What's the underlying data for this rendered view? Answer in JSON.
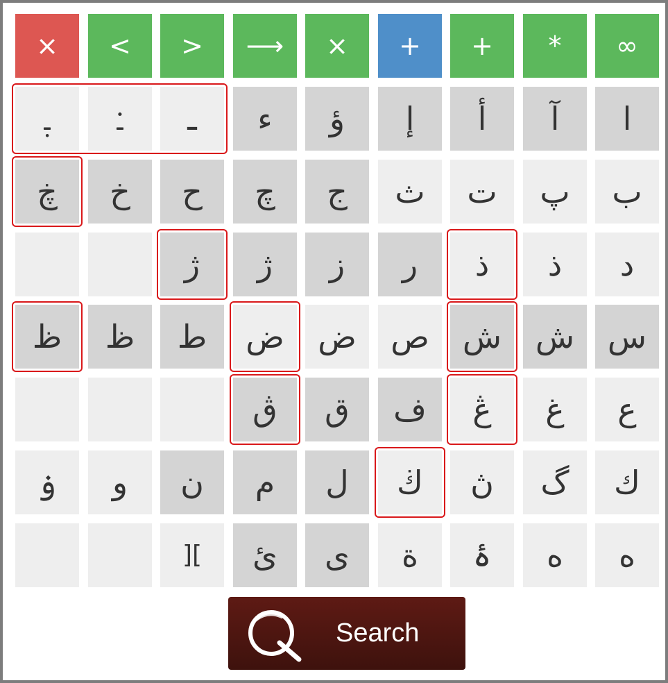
{
  "colors": {
    "clear": "#dd5752",
    "control": "#5cb85c",
    "control_active": "#4f8fc9",
    "key_light": "#eeeeee",
    "key_dark": "#d4d4d4",
    "text": "#333333",
    "outline": "#d9181a",
    "search_bg": "#4a1610"
  },
  "controls": [
    {
      "label": "×",
      "style": "clear",
      "name": "clear-button"
    },
    {
      "label": "<",
      "style": "control",
      "name": "left-arrow-button"
    },
    {
      "label": ">",
      "style": "control",
      "name": "right-arrow-button"
    },
    {
      "label": "⟶",
      "style": "control",
      "name": "long-arrow-button"
    },
    {
      "label": "×",
      "style": "control",
      "name": "backspace-button"
    },
    {
      "label": "+",
      "style": "control_active",
      "name": "plus-active-button"
    },
    {
      "label": "+",
      "style": "control",
      "name": "plus-button"
    },
    {
      "label": "*",
      "style": "control",
      "name": "wildcard-button"
    },
    {
      "label": "∞",
      "style": "control",
      "name": "infinity-button"
    }
  ],
  "rows": [
    [
      {
        "char": "ـٜ",
        "shade": "light",
        "marked": true
      },
      {
        "char": "ـ۬",
        "shade": "light",
        "marked": true
      },
      {
        "char": "ـ",
        "shade": "light",
        "marked": true
      },
      {
        "char": "ء",
        "shade": "dark"
      },
      {
        "char": "ؤ",
        "shade": "dark"
      },
      {
        "char": "إ",
        "shade": "dark"
      },
      {
        "char": "أ",
        "shade": "dark"
      },
      {
        "char": "آ",
        "shade": "dark"
      },
      {
        "char": "ا",
        "shade": "dark"
      }
    ],
    [
      {
        "char": "ڿ",
        "shade": "dark",
        "marked": true
      },
      {
        "char": "خ",
        "shade": "dark"
      },
      {
        "char": "ح",
        "shade": "dark"
      },
      {
        "char": "چ",
        "shade": "dark"
      },
      {
        "char": "ج",
        "shade": "dark"
      },
      {
        "char": "ث",
        "shade": "light"
      },
      {
        "char": "ت",
        "shade": "light"
      },
      {
        "char": "پ",
        "shade": "light"
      },
      {
        "char": "ب",
        "shade": "light"
      }
    ],
    [
      {
        "char": "",
        "shade": "blank"
      },
      {
        "char": "",
        "shade": "blank"
      },
      {
        "char": "ژ",
        "shade": "dark",
        "marked": true
      },
      {
        "char": "ژ",
        "shade": "dark"
      },
      {
        "char": "ز",
        "shade": "dark"
      },
      {
        "char": "ر",
        "shade": "dark"
      },
      {
        "char": "ذ",
        "shade": "light",
        "marked": true
      },
      {
        "char": "ذ",
        "shade": "light"
      },
      {
        "char": "د",
        "shade": "light"
      }
    ],
    [
      {
        "char": "ظ",
        "shade": "dark",
        "marked": true
      },
      {
        "char": "ظ",
        "shade": "dark"
      },
      {
        "char": "ط",
        "shade": "dark"
      },
      {
        "char": "ض",
        "shade": "light",
        "marked": true
      },
      {
        "char": "ض",
        "shade": "light"
      },
      {
        "char": "ص",
        "shade": "light"
      },
      {
        "char": "ش",
        "shade": "dark",
        "marked": true
      },
      {
        "char": "ش",
        "shade": "dark"
      },
      {
        "char": "س",
        "shade": "dark"
      }
    ],
    [
      {
        "char": "",
        "shade": "blank"
      },
      {
        "char": "",
        "shade": "blank"
      },
      {
        "char": "",
        "shade": "blank"
      },
      {
        "char": "ڨ",
        "shade": "dark",
        "marked": true
      },
      {
        "char": "ق",
        "shade": "dark"
      },
      {
        "char": "ف",
        "shade": "dark"
      },
      {
        "char": "ڠ",
        "shade": "light",
        "marked": true
      },
      {
        "char": "غ",
        "shade": "light"
      },
      {
        "char": "ع",
        "shade": "light"
      }
    ],
    [
      {
        "char": "ۏ",
        "shade": "light"
      },
      {
        "char": "و",
        "shade": "light"
      },
      {
        "char": "ن",
        "shade": "dark"
      },
      {
        "char": "م",
        "shade": "dark"
      },
      {
        "char": "ل",
        "shade": "dark"
      },
      {
        "char": "ڬ",
        "shade": "light",
        "marked": true
      },
      {
        "char": "ڽ",
        "shade": "light"
      },
      {
        "char": "گ",
        "shade": "light"
      },
      {
        "char": "ك",
        "shade": "light"
      }
    ],
    [
      {
        "char": "",
        "shade": "blank"
      },
      {
        "char": "",
        "shade": "blank"
      },
      {
        "char": "][",
        "shade": "light"
      },
      {
        "char": "ئ",
        "shade": "dark"
      },
      {
        "char": "ى",
        "shade": "dark"
      },
      {
        "char": "ة",
        "shade": "light"
      },
      {
        "char": "ۀ",
        "shade": "light"
      },
      {
        "char": "ه",
        "shade": "light"
      },
      {
        "char": "ه",
        "shade": "light"
      }
    ]
  ],
  "search": {
    "label": "Search",
    "icon": "search-icon"
  }
}
